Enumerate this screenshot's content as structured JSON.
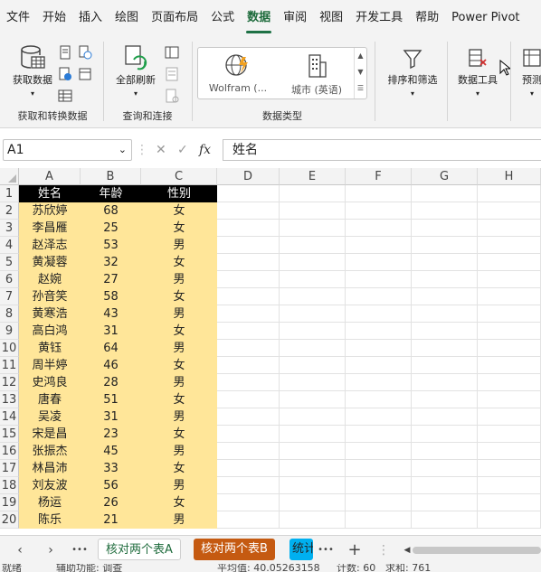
{
  "menu": {
    "items": [
      "文件",
      "开始",
      "插入",
      "绘图",
      "页面布局",
      "公式",
      "数据",
      "审阅",
      "视图",
      "开发工具",
      "帮助",
      "Power Pivot"
    ],
    "active_index": 6
  },
  "ribbon": {
    "get_data_label": "获取数据",
    "group1_label": "获取和转换数据",
    "refresh_all_label": "全部刷新",
    "group2_label": "查询和连接",
    "datatype_wolfram": "Wolfram (...",
    "datatype_city": "城市 (英语)",
    "group3_label": "数据类型",
    "sort_filter_label": "排序和筛选",
    "data_tools_label": "数据工具",
    "forecast_label": "预测"
  },
  "formula_bar": {
    "cell_ref": "A1",
    "fx": "fx",
    "content": "姓名"
  },
  "grid": {
    "columns": [
      "A",
      "B",
      "C",
      "D",
      "E",
      "F",
      "G",
      "H"
    ],
    "rows": [
      "1",
      "2",
      "3",
      "4",
      "5",
      "6",
      "7",
      "8",
      "9",
      "10",
      "11",
      "12",
      "13",
      "14",
      "15",
      "16",
      "17",
      "18",
      "19",
      "20"
    ],
    "headers": [
      "姓名",
      "年龄",
      "性别"
    ],
    "data": [
      [
        "苏欣婷",
        "68",
        "女"
      ],
      [
        "李昌雁",
        "25",
        "女"
      ],
      [
        "赵泽志",
        "53",
        "男"
      ],
      [
        "黄凝蓉",
        "32",
        "女"
      ],
      [
        "赵婉",
        "27",
        "男"
      ],
      [
        "孙音笑",
        "58",
        "女"
      ],
      [
        "黄寒浩",
        "43",
        "男"
      ],
      [
        "高白鸿",
        "31",
        "女"
      ],
      [
        "黄钰",
        "64",
        "男"
      ],
      [
        "周半婷",
        "46",
        "女"
      ],
      [
        "史鸿良",
        "28",
        "男"
      ],
      [
        "唐春",
        "51",
        "女"
      ],
      [
        "吴凌",
        "31",
        "男"
      ],
      [
        "宋是昌",
        "23",
        "女"
      ],
      [
        "张振杰",
        "45",
        "男"
      ],
      [
        "林昌沛",
        "33",
        "女"
      ],
      [
        "刘友波",
        "56",
        "男"
      ],
      [
        "杨运",
        "26",
        "女"
      ],
      [
        "陈乐",
        "21",
        "男"
      ]
    ],
    "colors": {
      "header_bg": "#000000",
      "data_bg": "#ffe699"
    }
  },
  "tabs": {
    "sheet1": "核对两个表A",
    "sheet2": "核对两个表B",
    "sheet3": "统计",
    "more": "•••",
    "add": "+"
  },
  "status": {
    "left": "就绪",
    "accessibility": "辅助功能: 调查",
    "average": "平均值: 40.05263158",
    "count": "计数: 60",
    "sum": "求和: 761"
  }
}
